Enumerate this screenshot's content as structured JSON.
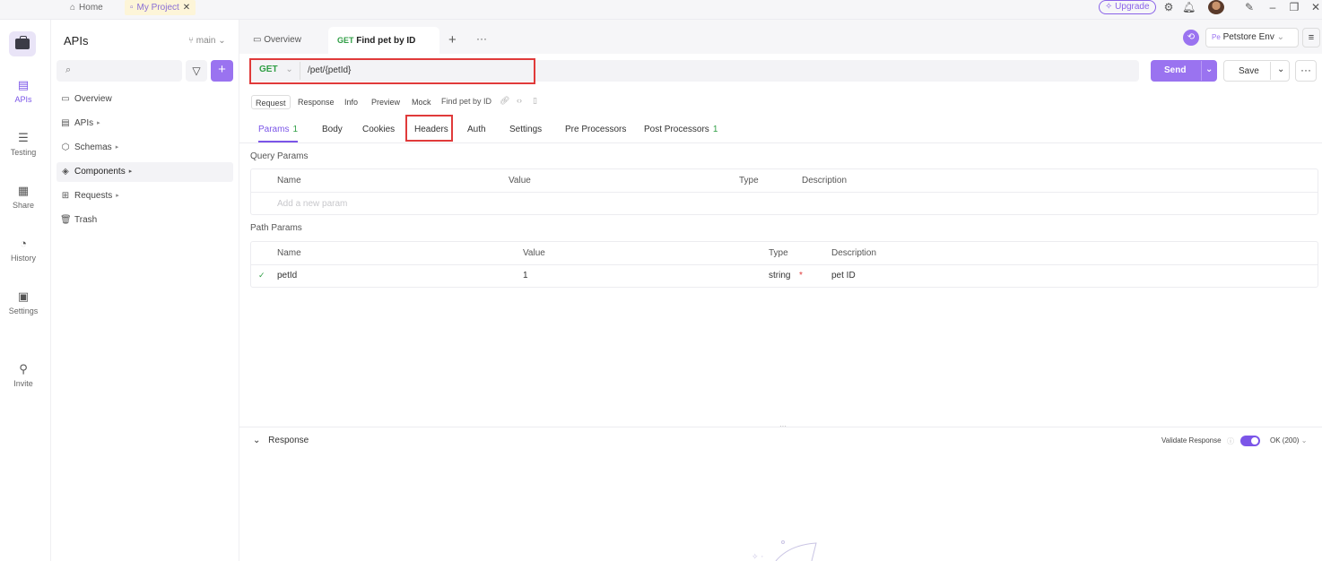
{
  "topbar": {
    "home_label": "Home",
    "project_label": "My Project",
    "upgrade_label": "Upgrade"
  },
  "rail": {
    "items": [
      {
        "label": "APIs",
        "icon": "api-icon"
      },
      {
        "label": "Testing",
        "icon": "testing-icon"
      },
      {
        "label": "Share",
        "icon": "share-icon"
      },
      {
        "label": "History",
        "icon": "history-icon"
      },
      {
        "label": "Settings",
        "icon": "settings-icon"
      },
      {
        "label": "Invite",
        "icon": "invite-icon"
      }
    ]
  },
  "sidebar": {
    "title": "APIs",
    "branch": "main",
    "items": [
      {
        "label": "Overview",
        "icon": "overview-icon"
      },
      {
        "label": "APIs",
        "icon": "apis-icon"
      },
      {
        "label": "Schemas",
        "icon": "schemas-icon"
      },
      {
        "label": "Components",
        "icon": "components-icon"
      },
      {
        "label": "Requests",
        "icon": "requests-icon"
      },
      {
        "label": "Trash",
        "icon": "trash-icon"
      }
    ]
  },
  "tabs": {
    "overview": "Overview",
    "active_method": "GET",
    "active_name": "Find pet by ID"
  },
  "env": {
    "prefix": "Pe",
    "name": "Petstore Env"
  },
  "request": {
    "method": "GET",
    "url": "/pet/{petId}",
    "send": "Send",
    "save": "Save"
  },
  "subtabs": [
    "Request",
    "Response",
    "Info",
    "Preview",
    "Mock"
  ],
  "api_name": "Find pet by ID",
  "param_tabs": {
    "params": "Params",
    "params_count": "1",
    "body": "Body",
    "cookies": "Cookies",
    "headers": "Headers",
    "auth": "Auth",
    "settings": "Settings",
    "pre": "Pre Processors",
    "post": "Post Processors",
    "post_count": "1"
  },
  "query": {
    "label": "Query Params",
    "headers": [
      "Name",
      "Value",
      "Type",
      "Description"
    ],
    "placeholder": "Add a new param"
  },
  "path": {
    "label": "Path Params",
    "headers": [
      "Name",
      "Value",
      "Type",
      "Description"
    ],
    "row": {
      "name": "petId",
      "value": "1",
      "type": "string",
      "required": "*",
      "description": "pet ID"
    }
  },
  "response": {
    "label": "Response",
    "validate": "Validate Response",
    "status": "OK (200)"
  },
  "colors": {
    "accent": "#9a73f0",
    "highlight": "#e03a3a",
    "method_green": "#2f9e44"
  }
}
